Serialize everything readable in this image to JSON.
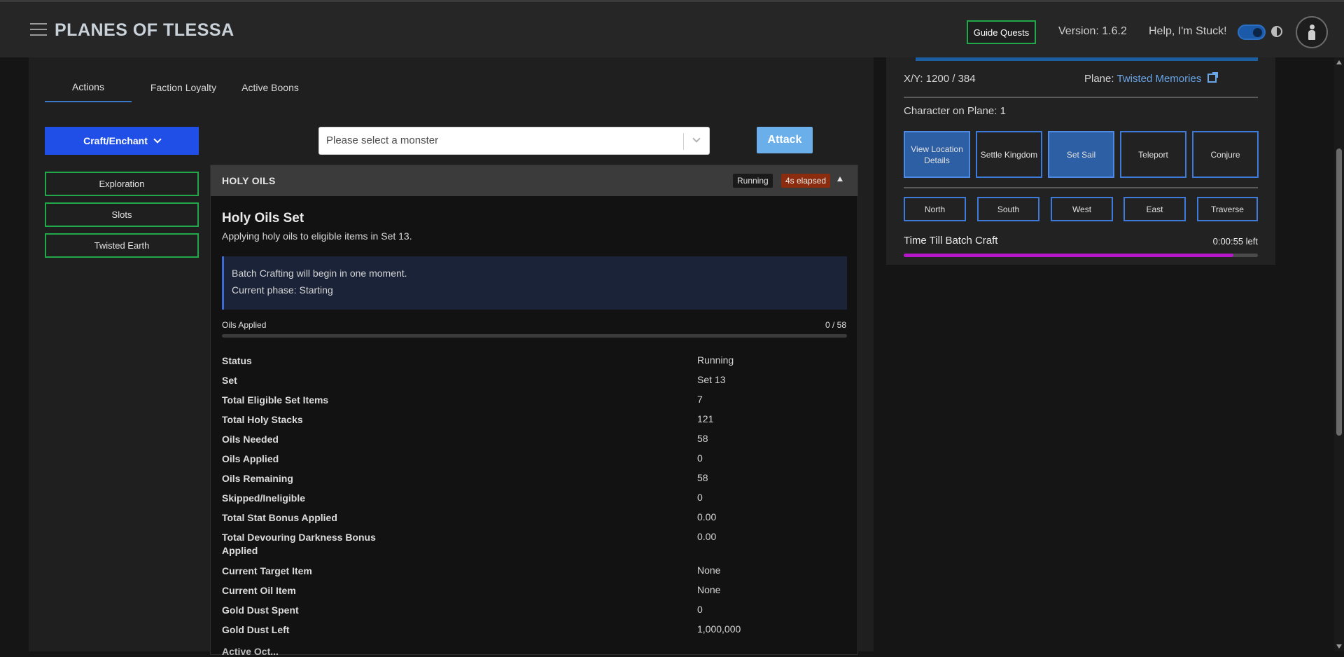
{
  "header": {
    "brand": "PLANES OF TLESSA",
    "guide_quests": "Guide Quests",
    "version": "Version: 1.6.2",
    "help": "Help, I'm Stuck!"
  },
  "tabs": [
    {
      "label": "Actions",
      "active": true
    },
    {
      "label": "Faction Loyalty",
      "active": false
    },
    {
      "label": "Active Boons",
      "active": false
    }
  ],
  "left_actions": {
    "craft_label": "Craft/Enchant",
    "buttons": [
      "Exploration",
      "Slots",
      "Twisted Earth"
    ]
  },
  "monster": {
    "placeholder": "Please select a monster",
    "attack_label": "Attack"
  },
  "holy_oils": {
    "title": "HOLY OILS",
    "status_badge": "Running",
    "elapsed_badge": "4s elapsed",
    "set_title": "Holy Oils Set",
    "description": "Applying holy oils to eligible items in Set 13.",
    "info_line1": "Batch Crafting will begin in one moment.",
    "info_line2": "Current phase: Starting",
    "progress_label": "Oils Applied",
    "progress_count": "0 / 58",
    "progress_fraction": 0,
    "rows": [
      {
        "label": "Status",
        "value": "Running"
      },
      {
        "label": "Set",
        "value": "Set 13"
      },
      {
        "label": "Total Eligible Set Items",
        "value": "7"
      },
      {
        "label": "Total Holy Stacks",
        "value": "121"
      },
      {
        "label": "Oils Needed",
        "value": "58"
      },
      {
        "label": "Oils Applied",
        "value": "0"
      },
      {
        "label": "Oils Remaining",
        "value": "58"
      },
      {
        "label": "Skipped/Ineligible",
        "value": "0"
      },
      {
        "label": "Total Stat Bonus Applied",
        "value": "0.00"
      },
      {
        "label": "Total Devouring Darkness Bonus Applied",
        "value": "0.00"
      },
      {
        "label": "Current Target Item",
        "value": "None"
      },
      {
        "label": "Current Oil Item",
        "value": "None"
      },
      {
        "label": "Gold Dust Spent",
        "value": "0"
      },
      {
        "label": "Gold Dust Left",
        "value": "1,000,000"
      }
    ],
    "partial_label": "Active Oct..."
  },
  "map_panel": {
    "coords": "X/Y: 1200 / 384",
    "plane_prefix": "Plane:",
    "plane_name": "Twisted Memories",
    "characters_on_plane": "Character on Plane: 1",
    "actions": [
      {
        "label": "View Location Details",
        "filled": true
      },
      {
        "label": "Settle Kingdom",
        "filled": false
      },
      {
        "label": "Set Sail",
        "filled": true
      },
      {
        "label": "Teleport",
        "filled": false
      },
      {
        "label": "Conjure",
        "filled": false
      }
    ],
    "directions": [
      "North",
      "South",
      "West",
      "East",
      "Traverse"
    ],
    "batch_label": "Time Till Batch Craft",
    "batch_time": "0:00:55 left",
    "batch_progress_fraction": 0.93
  },
  "colors": {
    "accent_blue": "#1f4fe6",
    "green_border": "#22a84a",
    "link_blue": "#6aa6e8",
    "batch_purple": "#b518c9",
    "elapsed_orange": "#8a2c0d"
  }
}
